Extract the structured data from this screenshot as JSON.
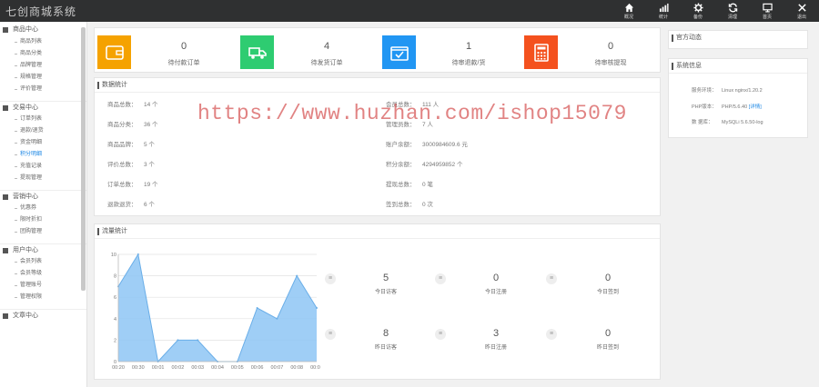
{
  "app": {
    "title": "七创商城系统"
  },
  "topnav": [
    {
      "icon": "home-icon",
      "label": "概况"
    },
    {
      "icon": "bar-chart-icon",
      "label": "统计"
    },
    {
      "icon": "gear-icon",
      "label": "备份"
    },
    {
      "icon": "refresh-icon",
      "label": "清理"
    },
    {
      "icon": "monitor-icon",
      "label": "首页"
    },
    {
      "icon": "close-icon",
      "label": "退出"
    }
  ],
  "sidebar": {
    "groups": [
      {
        "title": "商品中心",
        "items": [
          "商品列表",
          "商品分类",
          "品牌管理",
          "规格管理",
          "评价管理"
        ]
      },
      {
        "title": "交易中心",
        "items": [
          "订单列表",
          "退款/退货",
          "资金明细",
          "积分明细",
          "充值记录",
          "提现管理"
        ]
      },
      {
        "title": "营销中心",
        "items": [
          "优惠券",
          "限时折扣",
          "团购管理"
        ]
      },
      {
        "title": "用户中心",
        "items": [
          "会员列表",
          "会员等级",
          "管理账号",
          "管理权限"
        ]
      },
      {
        "title": "文章中心",
        "items": []
      }
    ],
    "active_item": "积分明细"
  },
  "orders": [
    {
      "value": "0",
      "label": "待付款订单",
      "color": "#f5a200",
      "icon": "wallet-icon"
    },
    {
      "value": "4",
      "label": "待发货订单",
      "color": "#2ecc71",
      "icon": "truck-icon"
    },
    {
      "value": "1",
      "label": "待审退款/货",
      "color": "#2196f3",
      "icon": "check-box-icon"
    },
    {
      "value": "0",
      "label": "待审核提现",
      "color": "#f4511e",
      "icon": "calculator-icon"
    }
  ],
  "data_stats": {
    "title": "数据统计",
    "left": [
      {
        "label": "商品总数：",
        "value": "14 个"
      },
      {
        "label": "商品分类：",
        "value": "36 个"
      },
      {
        "label": "商品品牌：",
        "value": "5 个"
      },
      {
        "label": "评价总数：",
        "value": "3 个"
      },
      {
        "label": "订单总数：",
        "value": "19 个"
      },
      {
        "label": "退款退货：",
        "value": "6 个"
      }
    ],
    "right": [
      {
        "label": "会员总数：",
        "value": "111 人"
      },
      {
        "label": "管理员数：",
        "value": "7 人"
      },
      {
        "label": "账户余额：",
        "value": "3000984609.6 元"
      },
      {
        "label": "积分余额：",
        "value": "4294959852 个"
      },
      {
        "label": "提现总数：",
        "value": "0 笔"
      },
      {
        "label": "签到总数：",
        "value": "0 次"
      }
    ]
  },
  "traffic": {
    "title": "流量统计",
    "kpis": [
      {
        "value": "5",
        "label": "今日访客"
      },
      {
        "value": "0",
        "label": "今日注册"
      },
      {
        "value": "0",
        "label": "今日签到"
      },
      {
        "value": "8",
        "label": "昨日访客"
      },
      {
        "value": "3",
        "label": "昨日注册"
      },
      {
        "value": "0",
        "label": "昨日签到"
      }
    ],
    "dot_symbol": "≡"
  },
  "chart_data": {
    "type": "area",
    "x": [
      "00:20",
      "00:30",
      "00:01",
      "00:02",
      "00:03",
      "00:04",
      "00:05",
      "00:06",
      "00:07",
      "00:08",
      "00:00"
    ],
    "values": [
      7,
      10,
      0,
      2,
      2,
      0,
      0,
      5,
      4,
      8,
      5
    ],
    "ylim": [
      0,
      10
    ],
    "yticks": [
      "0",
      "2",
      "4",
      "6",
      "8",
      "10"
    ],
    "fill_color": "#8ec5f5",
    "grid": true
  },
  "news": {
    "title": "官方动态"
  },
  "system": {
    "title": "系统信息",
    "rows": [
      {
        "label": "服务环境：",
        "value": "Linux nginx/1.20.2",
        "link": ""
      },
      {
        "label": "PHP版本：",
        "value": "PHP/5.6.40",
        "link": "[详情]"
      },
      {
        "label": "数  据库：",
        "value": "MySQLi 5.6.50-log",
        "link": ""
      }
    ]
  },
  "watermark": "https://www.huzhan.com/ishop15079"
}
